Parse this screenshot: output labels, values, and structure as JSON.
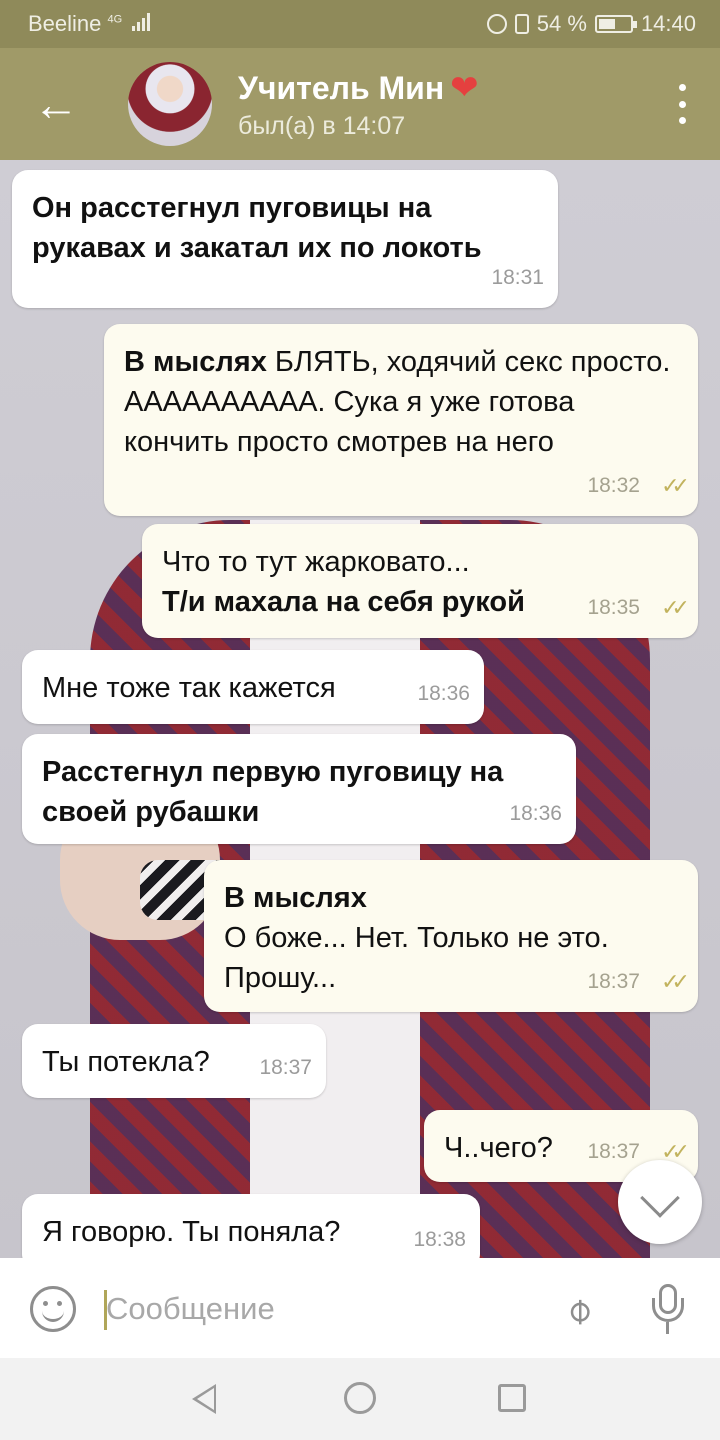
{
  "status_bar": {
    "carrier": "Beeline",
    "network": "4G",
    "battery": "54 %",
    "battery_level": 0.54,
    "time": "14:40"
  },
  "header": {
    "contact_name": "Учитель Мин",
    "contact_emoji": "❤",
    "last_seen": "был(а) в 14:07",
    "back_icon": "arrow-left-icon",
    "menu_icon": "more-vertical-icon"
  },
  "messages": [
    {
      "dir": "in",
      "bold": "Он расстегнул пуговицы на рукавах и закатал их по локоть",
      "text": "",
      "time": "18:31"
    },
    {
      "dir": "out",
      "bold": "В мыслях",
      "text": " БЛЯТЬ, ходячий секс просто. АААААААААА. Сука я уже готова кончить просто смотрев на него",
      "time": "18:32"
    },
    {
      "dir": "out",
      "text": "Что то тут жарковато...",
      "bold": "Т/и махала на себя рукой",
      "time": "18:35"
    },
    {
      "dir": "in",
      "text": "Мне тоже так кажется",
      "time": "18:36"
    },
    {
      "dir": "in",
      "bold": "Расстегнул первую пуговицу на своей рубашки",
      "text": "",
      "time": "18:36"
    },
    {
      "dir": "out",
      "bold": "В мыслях",
      "text": "О боже... Нет. Только не это. Прошу...",
      "time": "18:37"
    },
    {
      "dir": "in",
      "text": "Ты потекла?",
      "time": "18:37"
    },
    {
      "dir": "out",
      "text": "Ч..чего?",
      "time": "18:37"
    },
    {
      "dir": "in",
      "text": "Я говорю. Ты поняла?",
      "time": "18:38"
    }
  ],
  "input": {
    "placeholder": "Сообщение",
    "emoji_icon": "emoji-icon",
    "attach_icon": "paperclip-icon",
    "mic_icon": "microphone-icon"
  },
  "colors": {
    "header": "#a09a68",
    "status_bar": "#8f8a5a",
    "outgoing_bubble": "#fdfbef",
    "incoming_bubble": "#ffffff",
    "read_check": "#c2b35e"
  }
}
